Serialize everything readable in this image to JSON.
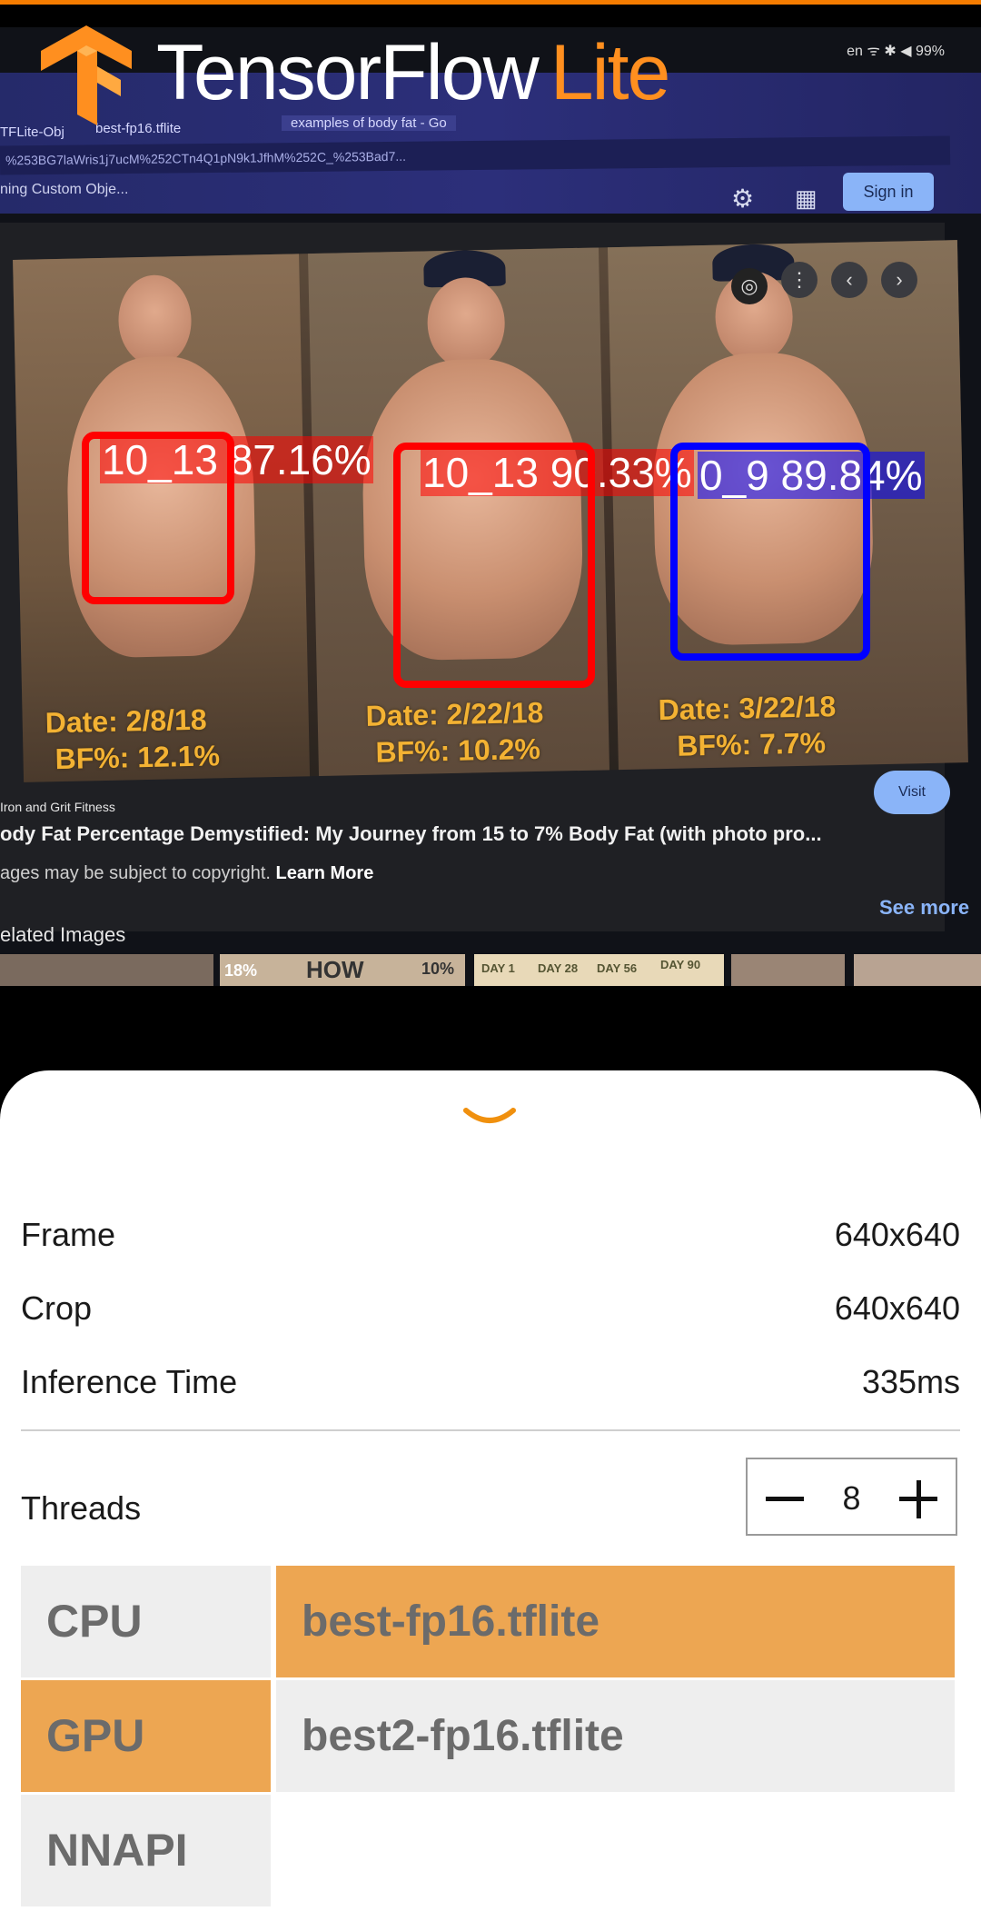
{
  "app": {
    "logo_primary": "TensorFlow",
    "logo_secondary": "Lite",
    "brand_orange": "#ff8f1f"
  },
  "camera_feed": {
    "status_bar": "en ᯤ ✱ ◀ 99%",
    "browser": {
      "tab1": "TFLite-Obj",
      "tab2": "best-fp16.tflite",
      "tab3": "examples of body fat - Go",
      "url": "%253BG7laWris1j7ucM%252CTn4Q1pN9k1JfhM%252C_%253Bad7...",
      "page_heading": "ning Custom Obje...",
      "signin": "Sign in",
      "gear_icon": "gear-icon",
      "apps_icon": "apps-grid-icon"
    },
    "result": {
      "captions": [
        {
          "date": "Date: 2/8/18",
          "bf": "BF%: 12.1%"
        },
        {
          "date": "Date: 2/22/18",
          "bf": "BF%: 10.2%"
        },
        {
          "date": "Date: 3/22/18",
          "bf": "BF%: 7.7%"
        }
      ],
      "source": "Iron and Grit Fitness",
      "title": "ody Fat Percentage Demystified: My Journey from 15 to 7% Body Fat (with photo pro...",
      "copyright": "ages may be subject to copyright.",
      "learn_more": "Learn More",
      "visit": "Visit",
      "see_more": "See more",
      "related": "elated Images",
      "thumb_texts": [
        "18%",
        "HOW",
        "10%",
        "DAY 1",
        "DAY 28",
        "DAY 56",
        "DAY 90"
      ]
    },
    "detections": [
      {
        "label": "10_13 87.16%",
        "color": "#ff0000"
      },
      {
        "label": "10_13 90.33%",
        "color": "#ff0000"
      },
      {
        "label": "0_9 89.84%",
        "color": "#0000ff"
      }
    ]
  },
  "sheet": {
    "expand_icon": "chevron-down-icon",
    "frame_label": "Frame",
    "frame_value": "640x640",
    "crop_label": "Crop",
    "crop_value": "640x640",
    "inference_label": "Inference Time",
    "inference_value": "335ms",
    "threads_label": "Threads",
    "threads_value": "8",
    "delegates": [
      "CPU",
      "GPU",
      "NNAPI"
    ],
    "selected_delegate": "GPU",
    "models": [
      "best-fp16.tflite",
      "best2-fp16.tflite"
    ],
    "selected_model": "best-fp16.tflite",
    "selected_color": "#eda652",
    "unselected_color": "#eeeeee"
  }
}
